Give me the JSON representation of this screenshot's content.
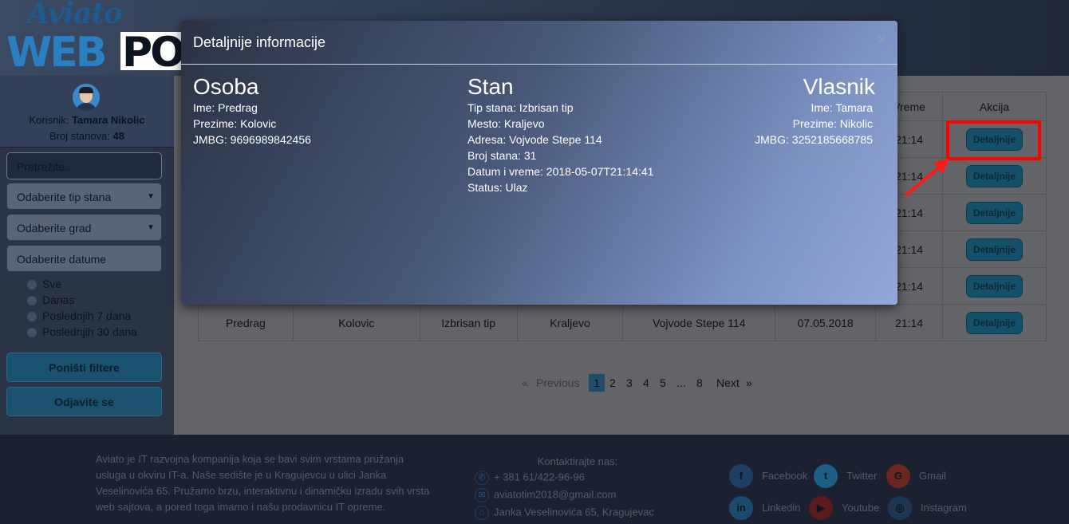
{
  "sidebar": {
    "user_label": "Korisnik:",
    "user_name": "Tamara Nikolic",
    "apartments_label": "Broj stanova:",
    "apartments_count": "48",
    "search_placeholder": "Pretražite...",
    "type_select": "Odaberite tip stana",
    "city_select": "Odaberite grad",
    "date_field": "Odaberite datume",
    "date_options": [
      "Sve",
      "Danas",
      "Poslednjih 7 dana",
      "Poslednjih 30 dana"
    ],
    "reset_button": "Poništi filtere",
    "logout_button": "Odjavite se"
  },
  "table": {
    "headers": {
      "vreme": "Vreme",
      "akcija": "Akcija"
    },
    "partial_time_cells": [
      "21:14",
      "21:14",
      "21:14",
      "21:14",
      "21:14"
    ],
    "last_row": [
      "Predrag",
      "Kolovic",
      "Izbrisan tip",
      "Kraljevo",
      "Vojvode Stepe 114",
      "07.05.2018",
      "21:14"
    ],
    "action_label": "Detaljnije"
  },
  "pagination": {
    "prev_arrow": "«",
    "previous": "Previous",
    "pages": [
      "1",
      "2",
      "3",
      "4",
      "5"
    ],
    "ellipsis": "...",
    "last_page": "8",
    "next": "Next",
    "next_arrow": "»",
    "active_page": "1"
  },
  "modal": {
    "title": "Detaljnije informacije",
    "close": "×",
    "osoba": {
      "heading": "Osoba",
      "lines": [
        "Ime: Predrag",
        "Prezime: Kolovic",
        "JMBG: 9696989842456"
      ]
    },
    "stan": {
      "heading": "Stan",
      "lines": [
        "Tip stana: Izbrisan tip",
        "Mesto: Kraljevo",
        "Adresa: Vojvode Stepe 114",
        "Broj stana: 31",
        "Datum i vreme: 2018-05-07T21:14:41",
        "Status: Ulaz"
      ]
    },
    "vlasnik": {
      "heading": "Vlasnik",
      "lines": [
        "Ime: Tamara",
        "Prezime: Nikolic",
        "JMBG: 3252185668785"
      ]
    }
  },
  "footer": {
    "about": "Aviato je IT razvojna kompanija koja se bavi svim vrstama pružanja usluga u okviru IT-a. Naše sedište je u Kragujevcu u ulici Janka Veselinovića 65. Pružamo brzu, interaktivnu i dinamičku izradu svih vrsta web sajtova, a pored toga imamo i našu prodavnicu IT opreme.",
    "contact_title": "Kontaktirajte nas:",
    "phone": "+ 381 61/422-96-96",
    "email": "aviatotim2018@gmail.com",
    "address": "Janka Veselinovića 65, Kragujevac",
    "social": [
      "Facebook",
      "Twitter",
      "Gmail",
      "Linkedin",
      "Youtube",
      "Instagram"
    ]
  },
  "logo": {
    "line1": "Aviato",
    "line2": "WEB",
    "line3": "PO"
  },
  "colors": {
    "accent": "#1d5b8e",
    "highlight": "#ff0000",
    "button": "#15506b"
  }
}
